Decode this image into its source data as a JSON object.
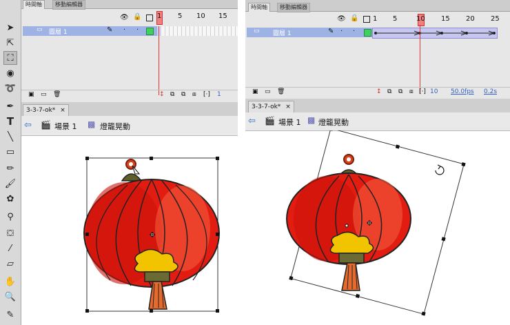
{
  "tools": {
    "items": [
      "selection-tool",
      "subselection-tool",
      "free-transform-tool",
      "3d-rotation-tool",
      "lasso-tool",
      "pen-tool",
      "text-tool",
      "line-tool",
      "rectangle-tool",
      "pencil-tool",
      "brush-tool",
      "deco-tool",
      "bone-tool",
      "paint-bucket-tool",
      "eyedropper-tool",
      "eraser-tool",
      "hand-tool",
      "zoom-tool",
      "stroke-color"
    ]
  },
  "left": {
    "tabs": {
      "timeline": "時間軸",
      "motion_editor": "移動編輯器"
    },
    "layer": {
      "name": "圖層 1"
    },
    "frame_numbers": [
      "1",
      "5",
      "10",
      "15"
    ],
    "timeline_footer": {
      "current_frame": "1"
    },
    "doc_tab": "3-3-7-ok*",
    "close": "×",
    "breadcrumb": {
      "scene": "場景 1",
      "symbol": "燈籠晃動"
    }
  },
  "right": {
    "tabs": {
      "timeline": "時間軸",
      "motion_editor": "移動編輯器"
    },
    "layer": {
      "name": "圖層 1"
    },
    "frame_numbers": [
      "1",
      "5",
      "10",
      "15",
      "20",
      "25"
    ],
    "timeline_footer": {
      "current_frame": "10",
      "fps": "50.0fps",
      "time": "0.2s"
    },
    "doc_tab": "3-3-7-ok*",
    "close": "×",
    "breadcrumb": {
      "scene": "場景 1",
      "symbol": "燈籠晃動"
    }
  }
}
